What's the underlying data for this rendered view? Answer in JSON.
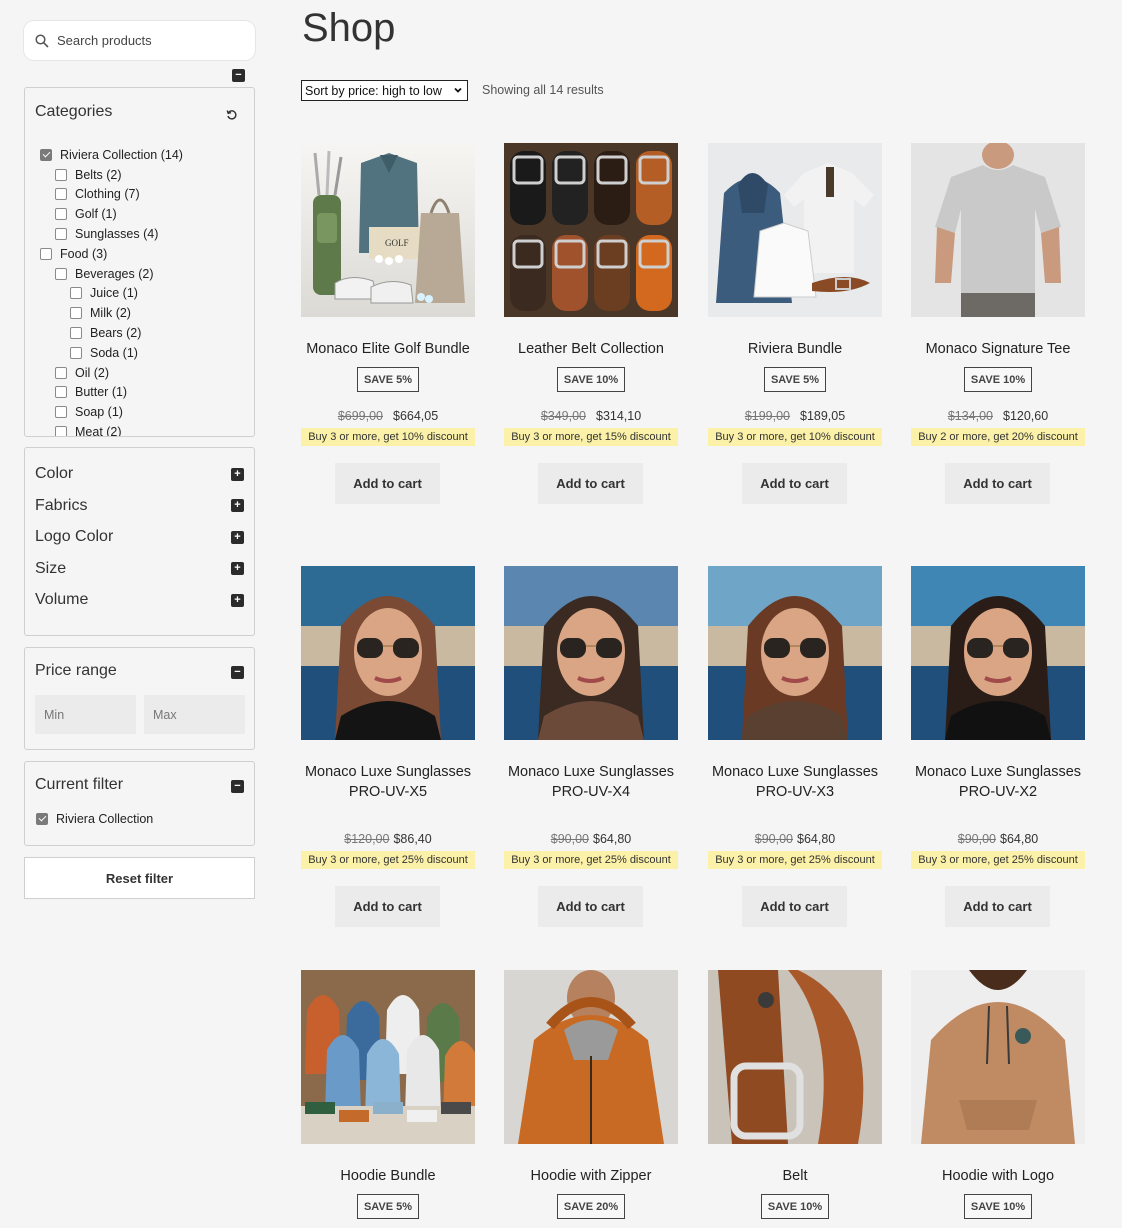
{
  "sidebar": {
    "search_placeholder": "Search products",
    "categories": {
      "title": "Categories",
      "items": [
        {
          "label": "Riviera Collection (14)",
          "level": 0,
          "checked": true
        },
        {
          "label": "Belts (2)",
          "level": 1,
          "checked": false
        },
        {
          "label": "Clothing (7)",
          "level": 1,
          "checked": false
        },
        {
          "label": "Golf (1)",
          "level": 1,
          "checked": false
        },
        {
          "label": "Sunglasses (4)",
          "level": 1,
          "checked": false
        },
        {
          "label": "Food (3)",
          "level": 0,
          "checked": false
        },
        {
          "label": "Beverages (2)",
          "level": 1,
          "checked": false
        },
        {
          "label": "Juice (1)",
          "level": 2,
          "checked": false
        },
        {
          "label": "Milk (2)",
          "level": 2,
          "checked": false
        },
        {
          "label": "Bears (2)",
          "level": 2,
          "checked": false
        },
        {
          "label": "Soda (1)",
          "level": 2,
          "checked": false
        },
        {
          "label": "Oil (2)",
          "level": 1,
          "checked": false
        },
        {
          "label": "Butter (1)",
          "level": 1,
          "checked": false
        },
        {
          "label": "Soap (1)",
          "level": 1,
          "checked": false
        },
        {
          "label": "Meat (2)",
          "level": 1,
          "checked": false
        }
      ]
    },
    "attributes": [
      "Color",
      "Fabrics",
      "Logo Color",
      "Size",
      "Volume"
    ],
    "price_range": {
      "title": "Price range",
      "min_placeholder": "Min",
      "max_placeholder": "Max"
    },
    "current_filter": {
      "title": "Current filter",
      "item": "Riviera Collection"
    },
    "reset_label": "Reset filter"
  },
  "main": {
    "title": "Shop",
    "sort_label": "Sort by price: high to low",
    "results_text": "Showing all 14 results",
    "add_to_cart_label": "Add to cart",
    "products": [
      {
        "name": "Monaco Elite Golf Bundle",
        "save": "SAVE 5%",
        "old_price": "$699,00",
        "price": "$664,05",
        "discount": "Buy 3 or more, get 10% discount",
        "image": "golf-bundle"
      },
      {
        "name": "Leather Belt Collection",
        "save": "SAVE 10%",
        "old_price": "$349,00",
        "price": "$314,10",
        "discount": "Buy 3 or more, get 15% discount",
        "image": "belts"
      },
      {
        "name": "Riviera Bundle",
        "save": "SAVE 5%",
        "old_price": "$199,00",
        "price": "$189,05",
        "discount": "Buy 3 or more, get 10% discount",
        "image": "clothing-bundle"
      },
      {
        "name": "Monaco Signature Tee",
        "save": "SAVE 10%",
        "old_price": "$134,00",
        "price": "$120,60",
        "discount": "Buy 2 or more, get 20% discount",
        "image": "tee"
      },
      {
        "name": "Monaco Luxe Sunglasses PRO-UV-X5",
        "save": "",
        "old_price": "$120,00",
        "price": "$86,40",
        "discount": "Buy 3 or more, get 25% discount",
        "image": "sunglasses-1"
      },
      {
        "name": "Monaco Luxe Sunglasses PRO-UV-X4",
        "save": "",
        "old_price": "$90,00",
        "price": "$64,80",
        "discount": "Buy 3 or more, get 25% discount",
        "image": "sunglasses-2"
      },
      {
        "name": "Monaco Luxe Sunglasses PRO-UV-X3",
        "save": "",
        "old_price": "$90,00",
        "price": "$64,80",
        "discount": "Buy 3 or more, get 25% discount",
        "image": "sunglasses-3"
      },
      {
        "name": "Monaco Luxe Sunglasses PRO-UV-X2",
        "save": "",
        "old_price": "$90,00",
        "price": "$64,80",
        "discount": "Buy 3 or more, get 25% discount",
        "image": "sunglasses-4"
      },
      {
        "name": "Hoodie Bundle",
        "save": "SAVE 5%",
        "image": "hoodie-bundle"
      },
      {
        "name": "Hoodie with Zipper",
        "save": "SAVE 20%",
        "image": "hoodie-zipper"
      },
      {
        "name": "Belt",
        "save": "SAVE 10%",
        "image": "belt"
      },
      {
        "name": "Hoodie with Logo",
        "save": "SAVE 10%",
        "image": "hoodie-logo"
      }
    ]
  },
  "colors": {
    "discount_bg": "#fbf1a9",
    "button_bg": "#ebebeb",
    "page_bg": "#f5f5f5"
  }
}
